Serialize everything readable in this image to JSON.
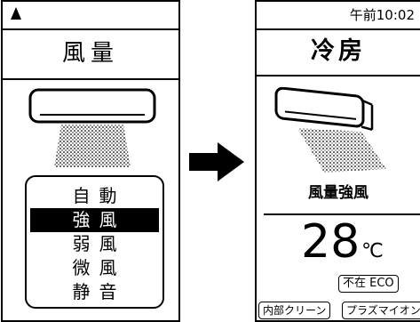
{
  "left_screen": {
    "title": "風量",
    "options": [
      {
        "label": "自動",
        "selected": false
      },
      {
        "label": "強風",
        "selected": true
      },
      {
        "label": "弱風",
        "selected": false
      },
      {
        "label": "微風",
        "selected": false
      },
      {
        "label": "静音",
        "selected": false
      }
    ],
    "icons": [
      "signal-icon",
      "air-conditioner-icon",
      "airflow-icon"
    ]
  },
  "transition": {
    "icon": "right-arrow-icon"
  },
  "right_screen": {
    "time": "午前10:02",
    "mode": "冷房",
    "fan_setting": "風量強風",
    "temperature": {
      "value": "28",
      "unit": "℃"
    },
    "badges": {
      "away_eco": "不在 ECO",
      "internal_clean": "内部クリーン",
      "plasma_ion": "プラズマイオン"
    }
  }
}
